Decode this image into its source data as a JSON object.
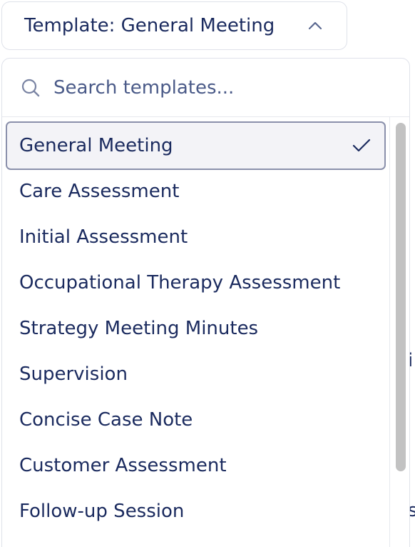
{
  "trigger": {
    "label": "Template: General Meeting",
    "chevron_icon": "chevron-up-icon"
  },
  "search": {
    "placeholder": "Search templates...",
    "icon": "search-icon"
  },
  "options": [
    {
      "label": "General Meeting",
      "selected": true
    },
    {
      "label": "Care Assessment",
      "selected": false
    },
    {
      "label": "Initial Assessment",
      "selected": false
    },
    {
      "label": "Occupational Therapy Assessment",
      "selected": false
    },
    {
      "label": "Strategy Meeting Minutes",
      "selected": false
    },
    {
      "label": "Supervision",
      "selected": false
    },
    {
      "label": "Concise Case Note",
      "selected": false
    },
    {
      "label": "Customer Assessment",
      "selected": false
    },
    {
      "label": "Follow-up Session",
      "selected": false
    }
  ],
  "background": {
    "fragment_1": "i",
    "fragment_2": "s"
  },
  "colors": {
    "text": "#1a2a5e",
    "selected_bg": "#f3f3f7",
    "selected_border": "#8a90ab",
    "scrollbar_thumb": "#c2c2c2"
  }
}
